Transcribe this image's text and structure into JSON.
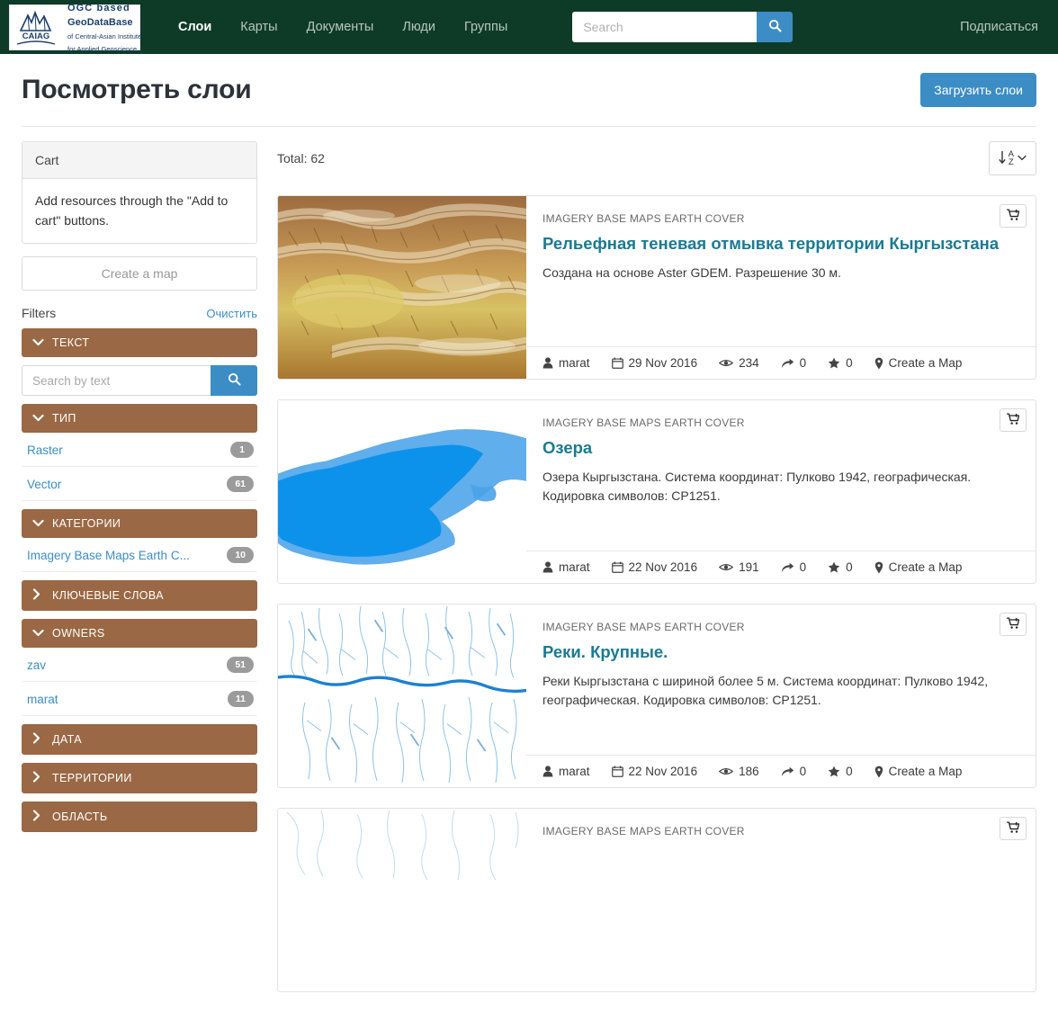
{
  "navbar": {
    "brand": {
      "logo_icon": "caiag-mountain-icon",
      "mark_text": "CAIAG",
      "line1": "OGC based",
      "line2": "GeoDataBase",
      "line3": "of Central-Asian Institute",
      "line4": "for Applied Geoscience"
    },
    "links": [
      {
        "label": "Слои",
        "active": true
      },
      {
        "label": "Карты",
        "active": false
      },
      {
        "label": "Документы",
        "active": false
      },
      {
        "label": "Люди",
        "active": false
      },
      {
        "label": "Группы",
        "active": false
      }
    ],
    "search": {
      "value": "",
      "placeholder": "Search",
      "icon": "search-icon"
    },
    "subscribe_label": "Подписаться",
    "background_color": "#0d3b28"
  },
  "header": {
    "title": "Посмотреть слои",
    "upload_button": "Загрузить слои",
    "accent_color": "#3c8dc5"
  },
  "sidebar": {
    "cart": {
      "title": "Cart",
      "empty_text": "Add resources through the \"Add to cart\" buttons."
    },
    "create_map_button": "Create a map",
    "filters_label": "Filters",
    "clear_label": "Очистить",
    "facet_color": "#9a6844",
    "text_facet": {
      "title": "ТЕКСТ",
      "expanded": true,
      "search_value": "",
      "search_placeholder": "Search by text",
      "search_icon": "search-icon"
    },
    "facets": [
      {
        "title": "ТИП",
        "expanded": true,
        "items": [
          {
            "label": "Raster",
            "count": "1"
          },
          {
            "label": "Vector",
            "count": "61"
          }
        ]
      },
      {
        "title": "КАТЕГОРИИ",
        "expanded": true,
        "items": [
          {
            "label": "Imagery Base Maps Earth C...",
            "count": "10"
          }
        ]
      },
      {
        "title": "КЛЮЧЕВЫЕ СЛОВА",
        "expanded": false,
        "items": []
      },
      {
        "title": "OWNERS",
        "expanded": true,
        "items": [
          {
            "label": "zav",
            "count": "51"
          },
          {
            "label": "marat",
            "count": "11"
          }
        ]
      },
      {
        "title": "ДАТА",
        "expanded": false,
        "items": []
      },
      {
        "title": "ТЕРРИТОРИИ",
        "expanded": false,
        "items": []
      },
      {
        "title": "ОБЛАСТЬ",
        "expanded": false,
        "items": []
      }
    ]
  },
  "results": {
    "total_label": "Total: 62",
    "sort": {
      "letters_top": "A",
      "letters_bottom": "Z",
      "icon": "sort-alpha-down-icon",
      "chevron": "chevron-down-icon"
    },
    "cards": [
      {
        "category": "IMAGERY BASE MAPS EARTH COVER",
        "title": "Рельефная теневая отмывка территории Кыргызстана",
        "description": "Создана на основе Aster GDEM. Разрешение 30 м.",
        "thumbnail": "hillshade-relief-thumbnail",
        "owner": "marat",
        "date": "29 Nov 2016",
        "views": "234",
        "shares": "0",
        "stars": "0",
        "action": "Create a Map",
        "cart_icon": "add-to-cart-icon"
      },
      {
        "category": "IMAGERY BASE MAPS EARTH COVER",
        "title": "Озера",
        "description": "Озера Кыргызстана. Система координат: Пулково 1942, географическая. Кодировка символов: CP1251.",
        "thumbnail": "lakes-thumbnail",
        "owner": "marat",
        "date": "22 Nov 2016",
        "views": "191",
        "shares": "0",
        "stars": "0",
        "action": "Create a Map",
        "cart_icon": "add-to-cart-icon"
      },
      {
        "category": "IMAGERY BASE MAPS EARTH COVER",
        "title": "Реки. Крупные.",
        "description": "Реки Кыргызстана с шириной более 5 м. Система координат: Пулково 1942, географическая. Кодировка символов: CP1251.",
        "thumbnail": "rivers-thumbnail",
        "owner": "marat",
        "date": "22 Nov 2016",
        "views": "186",
        "shares": "0",
        "stars": "0",
        "action": "Create a Map",
        "cart_icon": "add-to-cart-icon"
      },
      {
        "category": "IMAGERY BASE MAPS EARTH COVER",
        "title": "",
        "description": "",
        "thumbnail": "rivers-small-thumbnail",
        "owner": "",
        "date": "",
        "views": "",
        "shares": "",
        "stars": "",
        "action": "",
        "cart_icon": "add-to-cart-icon"
      }
    ]
  }
}
